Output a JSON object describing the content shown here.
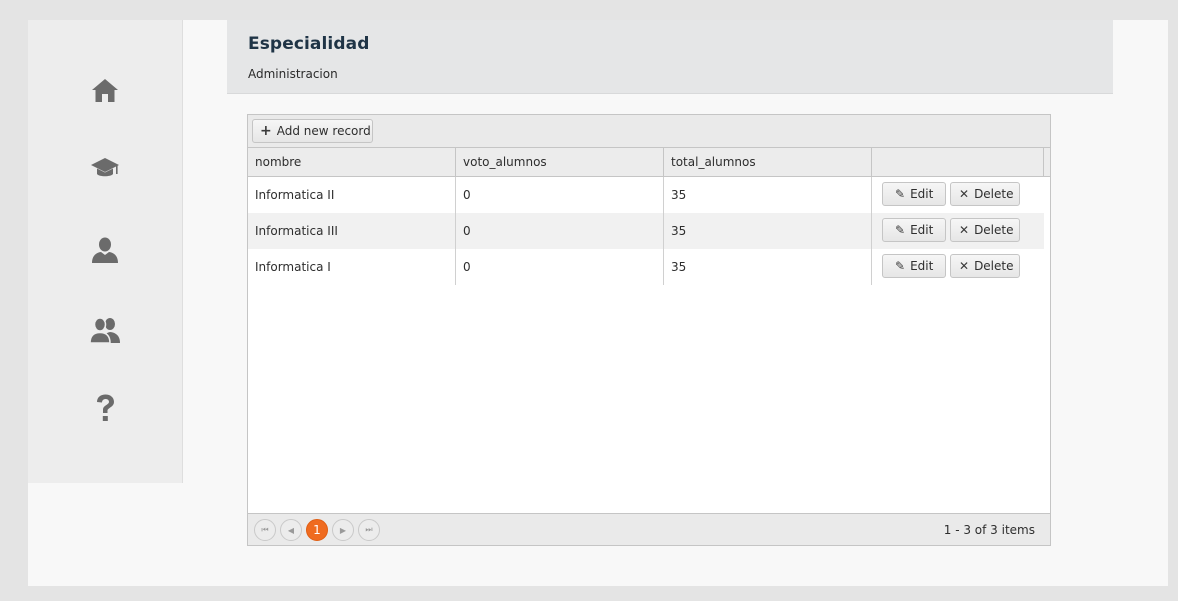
{
  "header": {
    "title": "Especialidad",
    "subtitle": "Administracion"
  },
  "sidebar": {
    "items": [
      {
        "icon": "home-icon"
      },
      {
        "icon": "graduation-cap-icon"
      },
      {
        "icon": "user-icon"
      },
      {
        "icon": "users-icon"
      },
      {
        "icon": "help-icon"
      }
    ]
  },
  "toolbar": {
    "add_label": "Add new record",
    "add_glyph": "+"
  },
  "table": {
    "columns": [
      "nombre",
      "voto_alumnos",
      "total_alumnos"
    ],
    "rows": [
      {
        "nombre": "Informatica II",
        "voto_alumnos": "0",
        "total_alumnos": "35"
      },
      {
        "nombre": "Informatica III",
        "voto_alumnos": "0",
        "total_alumnos": "35"
      },
      {
        "nombre": "Informatica I",
        "voto_alumnos": "0",
        "total_alumnos": "35"
      }
    ],
    "edit_label": "Edit",
    "delete_label": "Delete",
    "edit_glyph": "✎",
    "delete_glyph": "✕"
  },
  "pager": {
    "first_glyph": "⏮",
    "prev_glyph": "◀",
    "current_page": "1",
    "next_glyph": "▶",
    "last_glyph": "⏭",
    "info": "1 - 3 of 3 items"
  },
  "colors": {
    "accent": "#ef6b1f",
    "header_title": "#1f3446",
    "icon": "#6b6b6b"
  }
}
